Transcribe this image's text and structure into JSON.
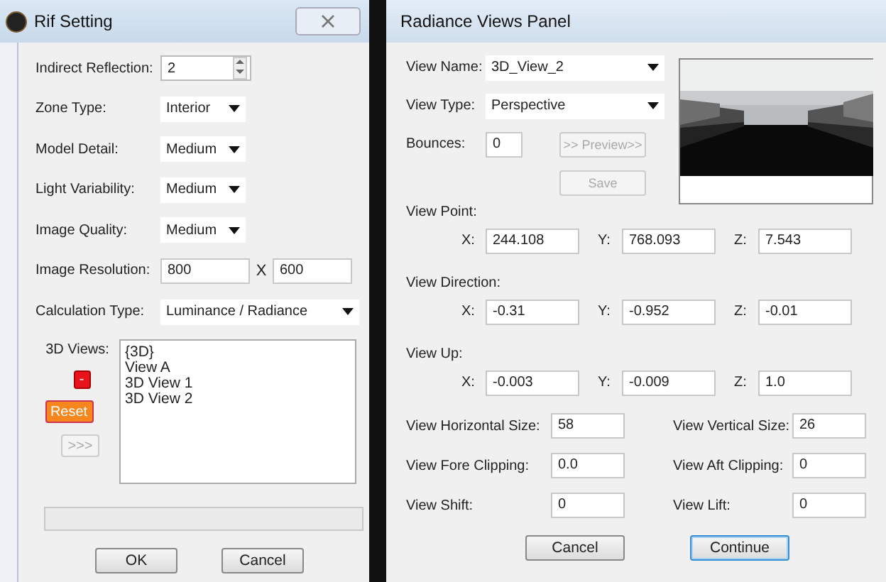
{
  "rif_setting": {
    "title": "Rif Setting",
    "fields": [
      {
        "label": "Indirect Reflection:",
        "kind": "spin",
        "value": "2"
      },
      {
        "label": "Zone Type:",
        "kind": "dropdown",
        "value": "Interior"
      },
      {
        "label": "Model Detail:",
        "kind": "dropdown",
        "value": "Medium"
      },
      {
        "label": "Light Variability:",
        "kind": "dropdown",
        "value": "Medium"
      },
      {
        "label": "Image Quality:",
        "kind": "dropdown",
        "value": "Medium"
      },
      {
        "label": "Image Resolution:",
        "kind": "pair",
        "value": "800",
        "separator": "X",
        "value_2": "600"
      },
      {
        "label": "Calculation Type:",
        "kind": "wide_dropdown",
        "value": "Luminance / Radiance"
      }
    ],
    "views_label": "3D Views:",
    "side_buttons": [
      {
        "label": "-",
        "kind": "remove",
        "disabled": false
      },
      {
        "label": "Reset",
        "kind": "reset",
        "disabled": false
      },
      {
        "label": ">>>",
        "kind": "plain",
        "disabled": true
      }
    ],
    "views": [
      "{3D}",
      "View A",
      "3D View 1",
      "3D View 2"
    ],
    "progress": {
      "level": 0
    },
    "buttons": [
      {
        "label": "OK",
        "focused": false
      },
      {
        "label": "Cancel",
        "focused": false
      }
    ]
  },
  "views_panel": {
    "title": "Radiance Views Panel",
    "view_name": {
      "label": "View Name:",
      "value": "3D_View_2"
    },
    "view_type": {
      "label": "View Type:",
      "value": "Perspective"
    },
    "bounces": {
      "label": "Bounces:",
      "value": "0"
    },
    "preview_button": {
      "label": ">> Preview>>",
      "disabled": true
    },
    "save_button": {
      "label": "Save",
      "disabled": true
    },
    "vectors": [
      {
        "label": "View Point:",
        "coords": [
          {
            "axis": "X:",
            "value": "244.108"
          },
          {
            "axis": "Y:",
            "value": "768.093"
          },
          {
            "axis": "Z:",
            "value": "7.543"
          }
        ]
      },
      {
        "label": "View Direction:",
        "coords": [
          {
            "axis": "X:",
            "value": "-0.31"
          },
          {
            "axis": "Y:",
            "value": "-0.952"
          },
          {
            "axis": "Z:",
            "value": "-0.01"
          }
        ]
      },
      {
        "label": "View Up:",
        "coords": [
          {
            "axis": "X:",
            "value": "-0.003"
          },
          {
            "axis": "Y:",
            "value": "-0.009"
          },
          {
            "axis": "Z:",
            "value": "1.0"
          }
        ]
      }
    ],
    "params": [
      {
        "label": "View Horizontal Size:",
        "value": "58"
      },
      {
        "label": "View Vertical Size:",
        "value": "26"
      },
      {
        "label": "View Fore Clipping:",
        "value": "0.0"
      },
      {
        "label": "View Aft Clipping:",
        "value": "0"
      },
      {
        "label": "View Shift:",
        "value": "0"
      },
      {
        "label": "View Lift:",
        "value": "0"
      }
    ],
    "buttons": [
      {
        "label": "Cancel",
        "focused": false
      },
      {
        "label": "Continue",
        "focused": true
      }
    ]
  }
}
